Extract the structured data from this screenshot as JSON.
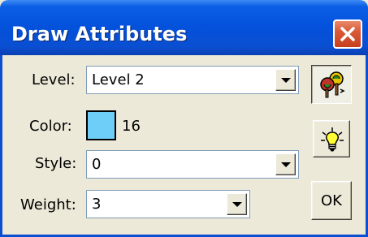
{
  "window": {
    "title": "Draw Attributes"
  },
  "form": {
    "level_label": "Level:",
    "level_value": "Level 2",
    "color_label": "Color:",
    "color_index": "16",
    "color_swatch": "#6fcef8",
    "style_label": "Style:",
    "style_value": "0",
    "weight_label": "Weight:",
    "weight_value": "3"
  },
  "buttons": {
    "match_icon": "paint-tree-icon",
    "highlight_icon": "lightbulb-icon",
    "ok_label": "OK"
  },
  "colors": {
    "titlebar": "#0a4fd1",
    "face": "#ece9d8",
    "close": "#d85a38"
  }
}
